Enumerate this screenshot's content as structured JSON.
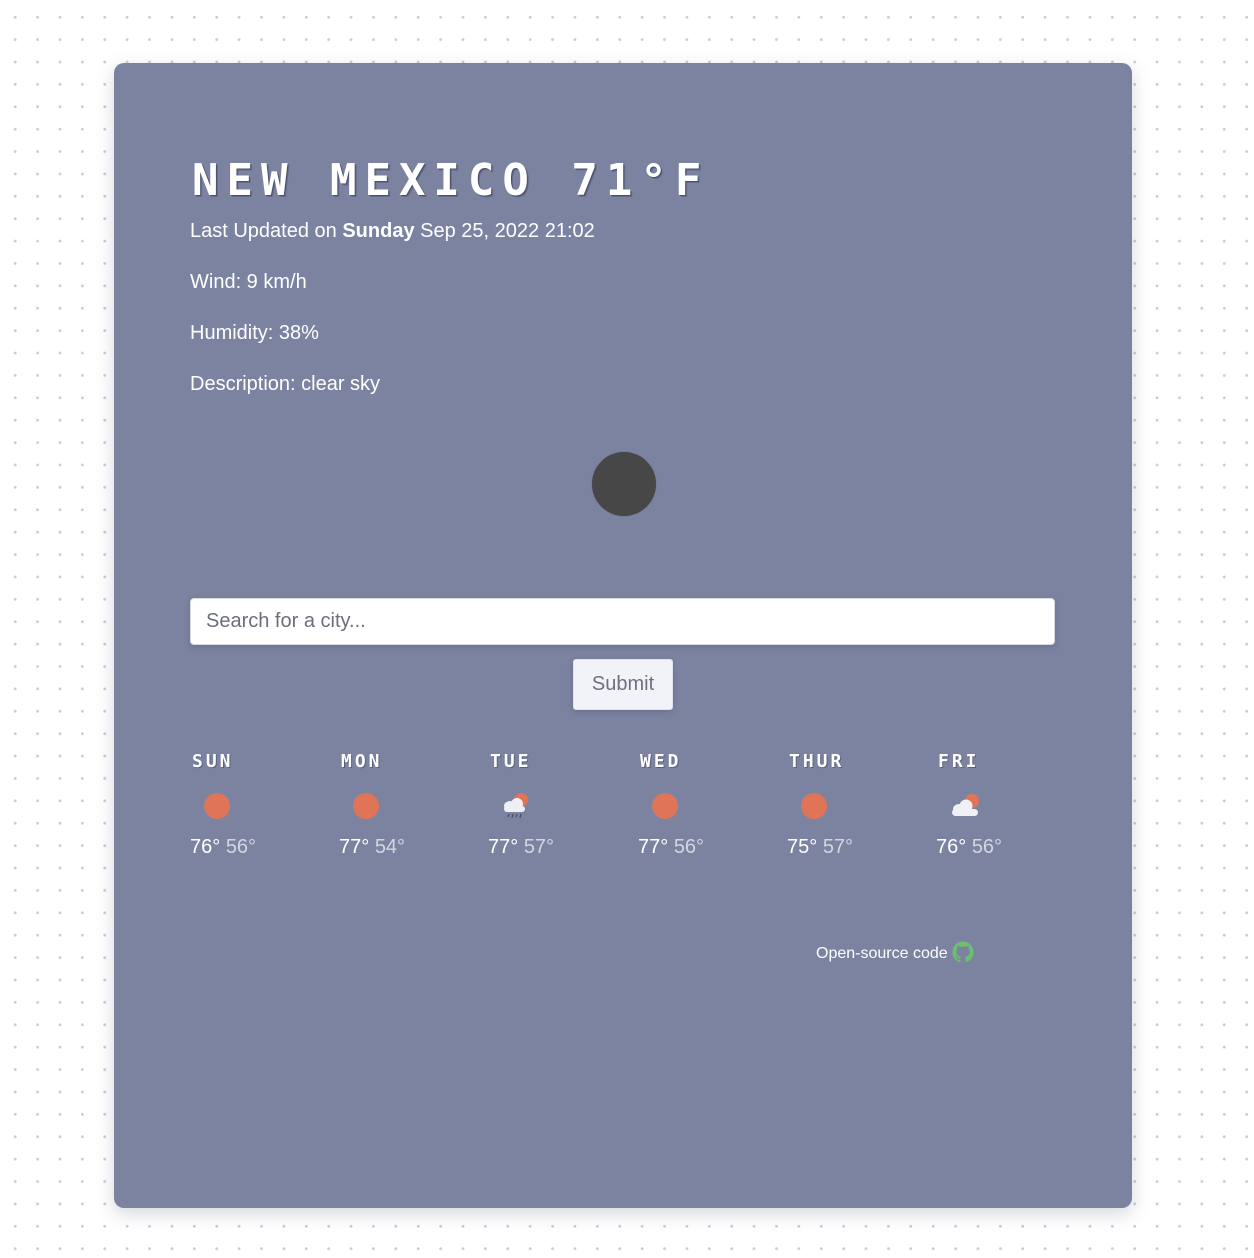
{
  "weather": {
    "city": "New Mexico",
    "temperature": "71°F",
    "updated_prefix": "Last Updated on ",
    "updated_day": "Sunday",
    "updated_rest": " Sep 25, 2022 21:02",
    "wind": "Wind: 9 km/h",
    "humidity": "Humidity: 38%",
    "description": "Description: clear sky",
    "main_icon": "moon-icon"
  },
  "search": {
    "placeholder": "Search for a city...",
    "value": "",
    "submit_label": "Submit"
  },
  "forecast": [
    {
      "day": "SUN",
      "icon": "sun-icon",
      "max": "76°",
      "min": "56°"
    },
    {
      "day": "MON",
      "icon": "sun-icon",
      "max": "77°",
      "min": "54°"
    },
    {
      "day": "TUE",
      "icon": "rain-cloud-sun-icon",
      "max": "77°",
      "min": "57°"
    },
    {
      "day": "WED",
      "icon": "sun-icon",
      "max": "77°",
      "min": "56°"
    },
    {
      "day": "THUR",
      "icon": "sun-icon",
      "max": "75°",
      "min": "57°"
    },
    {
      "day": "FRI",
      "icon": "cloud-sun-icon",
      "max": "76°",
      "min": "56°"
    }
  ],
  "footer": {
    "link_text": "Open-source code",
    "icon": "github-icon"
  },
  "colors": {
    "card": "#7b83a1",
    "sun": "#e07456",
    "moon": "#474747",
    "github": "#6cc06c"
  }
}
